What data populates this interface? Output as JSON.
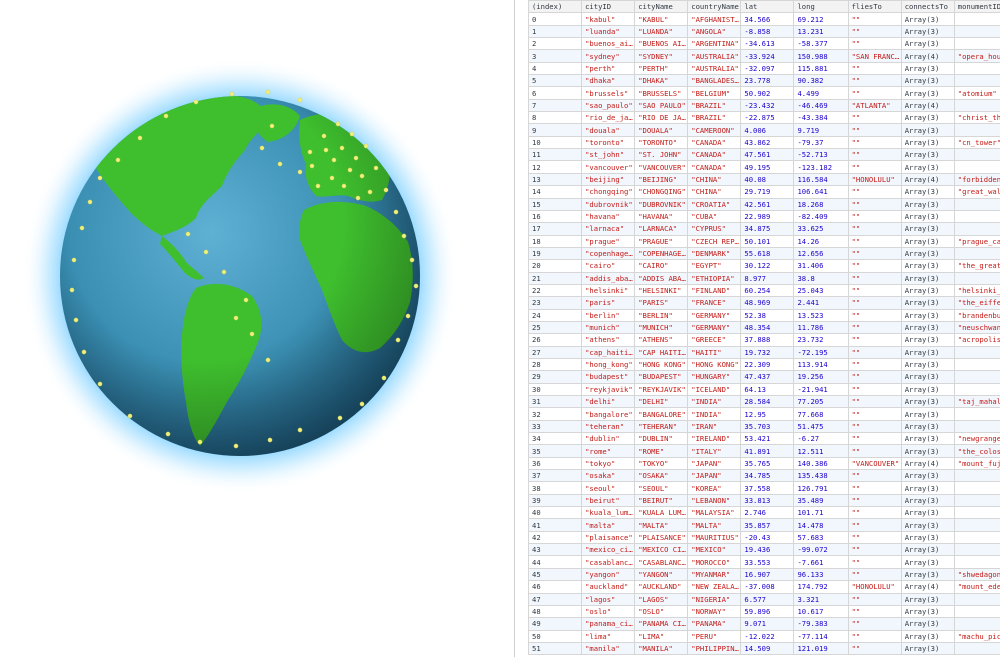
{
  "globe": {
    "label": "3D globe visualization",
    "colors": {
      "ocean": "#3a8fb3",
      "land": "#3fbf2e",
      "glow": "#7fd0ff",
      "marker": "#f0f07a"
    }
  },
  "table": {
    "headers": [
      "(index)",
      "cityID",
      "cityName",
      "countryName",
      "lat",
      "long",
      "fliesTo",
      "connectsTo",
      "monumentID"
    ],
    "rows": [
      [
        "0",
        "\"kabul\"",
        "\"KABUL\"",
        "\"AFGHANIST…",
        "34.566",
        "69.212",
        "\"\"",
        "Array(3)",
        ""
      ],
      [
        "1",
        "\"luanda\"",
        "\"LUANDA\"",
        "\"ANGOLA\"",
        "-8.858",
        "13.231",
        "\"\"",
        "Array(3)",
        ""
      ],
      [
        "2",
        "\"buenos_ai…",
        "\"BUENOS AI…",
        "\"ARGENTINA\"",
        "-34.613",
        "-58.377",
        "\"\"",
        "Array(3)",
        ""
      ],
      [
        "3",
        "\"sydney\"",
        "\"SYDNEY\"",
        "\"AUSTRALIA\"",
        "-33.924",
        "150.988",
        "\"SAN FRANC…",
        "Array(4)",
        "\"opera_hou…"
      ],
      [
        "4",
        "\"perth\"",
        "\"PERTH\"",
        "\"AUSTRALIA\"",
        "-32.097",
        "115.881",
        "\"\"",
        "Array(3)",
        ""
      ],
      [
        "5",
        "\"dhaka\"",
        "\"DHAKA\"",
        "\"BANGLADES…",
        "23.778",
        "90.382",
        "\"\"",
        "Array(3)",
        ""
      ],
      [
        "6",
        "\"brussels\"",
        "\"BRUSSELS\"",
        "\"BELGIUM\"",
        "50.902",
        "4.499",
        "\"\"",
        "Array(3)",
        "\"atomium\""
      ],
      [
        "7",
        "\"sao_paulo\"",
        "\"SAO PAULO\"",
        "\"BRAZIL\"",
        "-23.432",
        "-46.469",
        "\"ATLANTA\"",
        "Array(4)",
        ""
      ],
      [
        "8",
        "\"rio_de_ja…",
        "\"RIO DE JA…",
        "\"BRAZIL\"",
        "-22.875",
        "-43.384",
        "\"\"",
        "Array(3)",
        "\"christ_th…"
      ],
      [
        "9",
        "\"douala\"",
        "\"DOUALA\"",
        "\"CAMEROON\"",
        "4.006",
        "9.719",
        "\"\"",
        "Array(3)",
        ""
      ],
      [
        "10",
        "\"toronto\"",
        "\"TORONTO\"",
        "\"CANADA\"",
        "43.862",
        "-79.37",
        "\"\"",
        "Array(3)",
        "\"cn_tower\""
      ],
      [
        "11",
        "\"st_john\"",
        "\"ST. JOHN\"",
        "\"CANADA\"",
        "47.561",
        "-52.713",
        "\"\"",
        "Array(3)",
        ""
      ],
      [
        "12",
        "\"vancouver\"",
        "\"VANCOUVER\"",
        "\"CANADA\"",
        "49.195",
        "-123.182",
        "\"\"",
        "Array(3)",
        ""
      ],
      [
        "13",
        "\"beijing\"",
        "\"BEIJING\"",
        "\"CHINA\"",
        "40.08",
        "116.584",
        "\"HONOLULU\"",
        "Array(4)",
        "\"forbidden…"
      ],
      [
        "14",
        "\"chongqing\"",
        "\"CHONGQING\"",
        "\"CHINA\"",
        "29.719",
        "106.641",
        "\"\"",
        "Array(3)",
        "\"great_wal…"
      ],
      [
        "15",
        "\"dubrovnik\"",
        "\"DUBROVNIK\"",
        "\"CROATIA\"",
        "42.561",
        "18.268",
        "\"\"",
        "Array(3)",
        ""
      ],
      [
        "16",
        "\"havana\"",
        "\"HAVANA\"",
        "\"CUBA\"",
        "22.989",
        "-82.409",
        "\"\"",
        "Array(3)",
        ""
      ],
      [
        "17",
        "\"larnaca\"",
        "\"LARNACA\"",
        "\"CYPRUS\"",
        "34.875",
        "33.625",
        "\"\"",
        "Array(3)",
        ""
      ],
      [
        "18",
        "\"prague\"",
        "\"PRAGUE\"",
        "\"CZECH REP…",
        "50.101",
        "14.26",
        "\"\"",
        "Array(3)",
        "\"prague_ca…"
      ],
      [
        "19",
        "\"copenhage…",
        "\"COPENHAGE…",
        "\"DENMARK\"",
        "55.618",
        "12.656",
        "\"\"",
        "Array(3)",
        ""
      ],
      [
        "20",
        "\"cairo\"",
        "\"CAIRO\"",
        "\"EGYPT\"",
        "30.122",
        "31.406",
        "\"\"",
        "Array(3)",
        "\"the_great…"
      ],
      [
        "21",
        "\"addis_aba…",
        "\"ADDIS ABA…",
        "\"ETHIOPIA\"",
        "8.977",
        "38.8",
        "\"\"",
        "Array(3)",
        ""
      ],
      [
        "22",
        "\"helsinki\"",
        "\"HELSINKI\"",
        "\"FINLAND\"",
        "60.254",
        "25.043",
        "\"\"",
        "Array(3)",
        "\"helsinki_…"
      ],
      [
        "23",
        "\"paris\"",
        "\"PARIS\"",
        "\"FRANCE\"",
        "48.969",
        "2.441",
        "\"\"",
        "Array(3)",
        "\"the_eiffe…"
      ],
      [
        "24",
        "\"berlin\"",
        "\"BERLIN\"",
        "\"GERMANY\"",
        "52.38",
        "13.523",
        "\"\"",
        "Array(3)",
        "\"brandenbu…"
      ],
      [
        "25",
        "\"munich\"",
        "\"MUNICH\"",
        "\"GERMANY\"",
        "48.354",
        "11.786",
        "\"\"",
        "Array(3)",
        "\"neuschwan…"
      ],
      [
        "26",
        "\"athens\"",
        "\"ATHENS\"",
        "\"GREECE\"",
        "37.888",
        "23.732",
        "\"\"",
        "Array(3)",
        "\"acropolis\""
      ],
      [
        "27",
        "\"cap_haiti…",
        "\"CAP HAITI…",
        "\"HAITI\"",
        "19.732",
        "-72.195",
        "\"\"",
        "Array(3)",
        ""
      ],
      [
        "28",
        "\"hong_kong\"",
        "\"HONG KONG\"",
        "\"HONG KONG\"",
        "22.309",
        "113.914",
        "\"\"",
        "Array(3)",
        ""
      ],
      [
        "29",
        "\"budapest\"",
        "\"BUDAPEST\"",
        "\"HUNGARY\"",
        "47.437",
        "19.256",
        "\"\"",
        "Array(3)",
        ""
      ],
      [
        "30",
        "\"reykjavik\"",
        "\"REYKJAVIK\"",
        "\"ICELAND\"",
        "64.13",
        "-21.941",
        "\"\"",
        "Array(3)",
        ""
      ],
      [
        "31",
        "\"delhi\"",
        "\"DELHI\"",
        "\"INDIA\"",
        "28.584",
        "77.205",
        "\"\"",
        "Array(3)",
        "\"taj_mahal\""
      ],
      [
        "32",
        "\"bangalore\"",
        "\"BANGALORE\"",
        "\"INDIA\"",
        "12.95",
        "77.668",
        "\"\"",
        "Array(3)",
        ""
      ],
      [
        "33",
        "\"teheran\"",
        "\"TEHERAN\"",
        "\"IRAN\"",
        "35.703",
        "51.475",
        "\"\"",
        "Array(3)",
        ""
      ],
      [
        "34",
        "\"dublin\"",
        "\"DUBLIN\"",
        "\"IRELAND\"",
        "53.421",
        "-6.27",
        "\"\"",
        "Array(3)",
        "\"newgrange…"
      ],
      [
        "35",
        "\"rome\"",
        "\"ROME\"",
        "\"ITALY\"",
        "41.891",
        "12.511",
        "\"\"",
        "Array(3)",
        "\"the_colos…"
      ],
      [
        "36",
        "\"tokyo\"",
        "\"TOKYO\"",
        "\"JAPAN\"",
        "35.765",
        "140.386",
        "\"VANCOUVER\"",
        "Array(4)",
        "\"mount_fuj…"
      ],
      [
        "37",
        "\"osaka\"",
        "\"OSAKA\"",
        "\"JAPAN\"",
        "34.785",
        "135.438",
        "\"\"",
        "Array(3)",
        ""
      ],
      [
        "38",
        "\"seoul\"",
        "\"SEOUL\"",
        "\"KOREA\"",
        "37.558",
        "126.791",
        "\"\"",
        "Array(3)",
        ""
      ],
      [
        "39",
        "\"beirut\"",
        "\"BEIRUT\"",
        "\"LEBANON\"",
        "33.813",
        "35.489",
        "\"\"",
        "Array(3)",
        ""
      ],
      [
        "40",
        "\"kuala_lum…",
        "\"KUALA LUM…",
        "\"MALAYSIA\"",
        "2.746",
        "101.71",
        "\"\"",
        "Array(3)",
        ""
      ],
      [
        "41",
        "\"malta\"",
        "\"MALTA\"",
        "\"MALTA\"",
        "35.857",
        "14.478",
        "\"\"",
        "Array(3)",
        ""
      ],
      [
        "42",
        "\"plaisance\"",
        "\"PLAISANCE\"",
        "\"MAURITIUS\"",
        "-20.43",
        "57.683",
        "\"\"",
        "Array(3)",
        ""
      ],
      [
        "43",
        "\"mexico_ci…",
        "\"MEXICO CI…",
        "\"MEXICO\"",
        "19.436",
        "-99.072",
        "\"\"",
        "Array(3)",
        ""
      ],
      [
        "44",
        "\"casablanc…",
        "\"CASABLANC…",
        "\"MOROCCO\"",
        "33.553",
        "-7.661",
        "\"\"",
        "Array(3)",
        ""
      ],
      [
        "45",
        "\"yangon\"",
        "\"YANGON\"",
        "\"MYANMAR\"",
        "16.907",
        "96.133",
        "\"\"",
        "Array(3)",
        "\"shwedagon…"
      ],
      [
        "46",
        "\"auckland\"",
        "\"AUCKLAND\"",
        "\"NEW ZEALA…",
        "-37.008",
        "174.792",
        "\"HONOLULU\"",
        "Array(4)",
        "\"mount_ede…"
      ],
      [
        "47",
        "\"lagos\"",
        "\"LAGOS\"",
        "\"NIGERIA\"",
        "6.577",
        "3.321",
        "\"\"",
        "Array(3)",
        ""
      ],
      [
        "48",
        "\"oslo\"",
        "\"OSLO\"",
        "\"NORWAY\"",
        "59.896",
        "10.617",
        "\"\"",
        "Array(3)",
        ""
      ],
      [
        "49",
        "\"panama_ci…",
        "\"PANAMA CI…",
        "\"PANAMA\"",
        "9.071",
        "-79.383",
        "\"\"",
        "Array(3)",
        ""
      ],
      [
        "50",
        "\"lima\"",
        "\"LIMA\"",
        "\"PERU\"",
        "-12.022",
        "-77.114",
        "\"\"",
        "Array(3)",
        "\"machu_pic…"
      ],
      [
        "51",
        "\"manila\"",
        "\"MANILA\"",
        "\"PHILIPPIN…",
        "14.509",
        "121.019",
        "\"\"",
        "Array(3)",
        ""
      ]
    ]
  }
}
